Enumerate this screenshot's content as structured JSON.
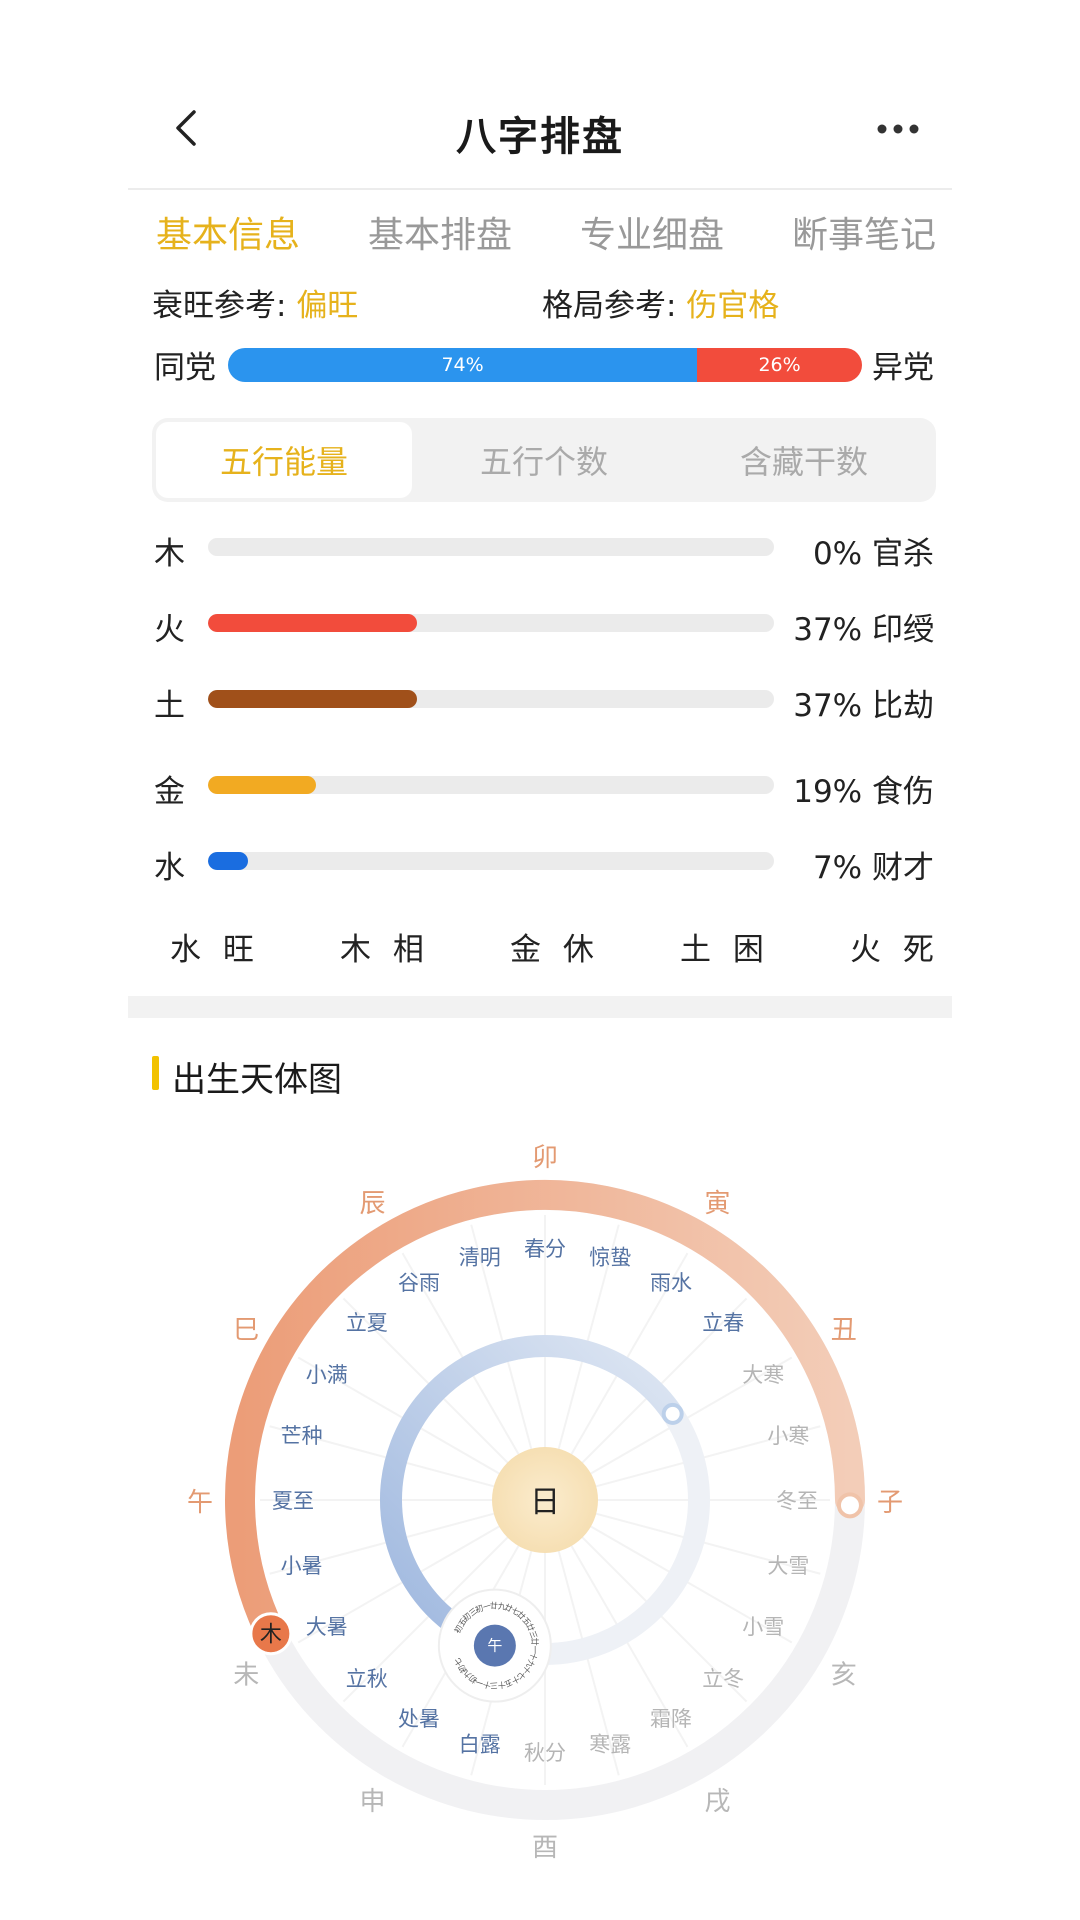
{
  "header": {
    "title": "八字排盘",
    "back_icon": "chevron-left-icon",
    "more_icon": "more-horizontal-icon"
  },
  "tabs": [
    {
      "label": "基本信息",
      "active": true
    },
    {
      "label": "基本排盘",
      "active": false
    },
    {
      "label": "专业细盘",
      "active": false
    },
    {
      "label": "断事笔记",
      "active": false
    }
  ],
  "reference": {
    "strength_label": "衰旺参考:",
    "strength_value": "偏旺",
    "pattern_label": "格局参考:",
    "pattern_value": "伤官格"
  },
  "party": {
    "left_label": "同党",
    "right_label": "异党",
    "same_percent": 74,
    "same_text": "74%",
    "diff_percent": 26,
    "diff_text": "26%",
    "same_color": "#2b94ee",
    "diff_color": "#f24c3c"
  },
  "segments": [
    {
      "label": "五行能量",
      "active": true
    },
    {
      "label": "五行个数",
      "active": false
    },
    {
      "label": "含藏干数",
      "active": false
    }
  ],
  "elements": [
    {
      "name": "木",
      "percent": 0,
      "value_text": "0% 官杀",
      "color": "#9bbf4a"
    },
    {
      "name": "火",
      "percent": 37,
      "value_text": "37% 印绶",
      "color": "#f24c3c"
    },
    {
      "name": "土",
      "percent": 37,
      "value_text": "37% 比劫",
      "color": "#a0501a"
    },
    {
      "name": "金",
      "percent": 19,
      "value_text": "19% 食伤",
      "color": "#f2aa22"
    },
    {
      "name": "水",
      "percent": 7,
      "value_text": "7% 财才",
      "color": "#1a6de0"
    }
  ],
  "seasons": [
    "水 旺",
    "木 相",
    "金 休",
    "土 困",
    "火 死"
  ],
  "section_title": "出生天体图",
  "chart": {
    "branches": [
      "卯",
      "寅",
      "丑",
      "子",
      "亥",
      "戌",
      "酉",
      "申",
      "未",
      "午",
      "巳",
      "辰"
    ],
    "solar_terms": [
      "春分",
      "惊蛰",
      "雨水",
      "立春",
      "大寒",
      "小寒",
      "冬至",
      "大雪",
      "小雪",
      "立冬",
      "霜降",
      "寒露",
      "秋分",
      "白露",
      "处暑",
      "立秋",
      "大暑",
      "小暑",
      "夏至",
      "芒种",
      "小满",
      "立夏",
      "谷雨",
      "清明"
    ],
    "sun_label": "日",
    "wood_label": "木",
    "moon_center_label": "午",
    "moon_days": [
      "初五",
      "初三",
      "初一",
      "廿九",
      "廿七",
      "廿五",
      "廿三",
      "廿一",
      "十九",
      "十七",
      "十五",
      "十三",
      "十一",
      "初九",
      "初七"
    ],
    "outer_arc_color": "#eda47e",
    "inner_arc_color": "#a9c0e0",
    "sun_color": "#f8e4bd",
    "wood_marker_color": "#e8784a",
    "moon_color": "#5a77b0"
  }
}
